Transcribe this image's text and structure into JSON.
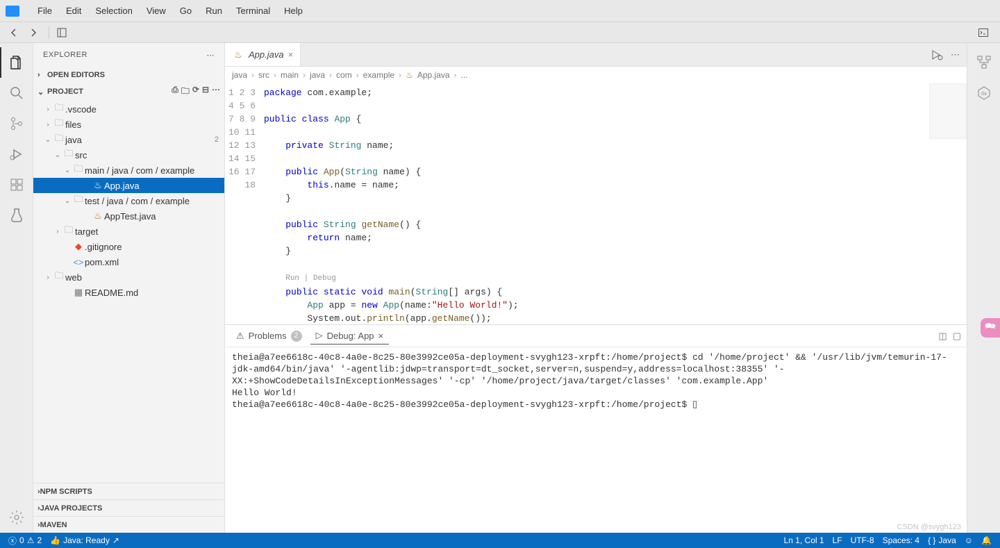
{
  "menu": [
    "File",
    "Edit",
    "Selection",
    "View",
    "Go",
    "Run",
    "Terminal",
    "Help"
  ],
  "sidebar": {
    "title": "EXPLORER",
    "openEditors": "OPEN EDITORS",
    "project": "PROJECT",
    "tree": {
      "vscode": ".vscode",
      "files": "files",
      "java": "java",
      "javaBadge": "2",
      "src": "src",
      "mainPath": "main / java / com / example",
      "appJava": "App.java",
      "testPath": "test / java / com / example",
      "appTest": "AppTest.java",
      "target": "target",
      "gitignore": ".gitignore",
      "pom": "pom.xml",
      "web": "web",
      "readme": "README.md"
    },
    "bottom": [
      "NPM SCRIPTS",
      "JAVA PROJECTS",
      "MAVEN"
    ]
  },
  "tab": {
    "label": "App.java"
  },
  "breadcrumb": [
    "java",
    "src",
    "main",
    "java",
    "com",
    "example",
    "App.java",
    "..."
  ],
  "codelens": "Run | Debug",
  "code": {
    "lines": [
      {
        "n": 1
      },
      {
        "n": 2
      },
      {
        "n": 3
      },
      {
        "n": 4
      },
      {
        "n": 5
      },
      {
        "n": 6
      },
      {
        "n": 7
      },
      {
        "n": 8
      },
      {
        "n": 9
      },
      {
        "n": 10
      },
      {
        "n": 11
      },
      {
        "n": 12
      },
      {
        "n": 13
      },
      {
        "n": 14
      },
      {
        "n": 15
      },
      {
        "n": 16
      },
      {
        "n": 17
      },
      {
        "n": 18
      }
    ]
  },
  "panel": {
    "problems": "Problems",
    "problemsCount": "2",
    "debug": "Debug: App"
  },
  "terminal": "theia@a7ee6618c-40c8-4a0e-8c25-80e3992ce05a-deployment-svygh123-xrpft:/home/project$ cd '/home/project' && '/usr/lib/jvm/temurin-17-jdk-amd64/bin/java' '-agentlib:jdwp=transport=dt_socket,server=n,suspend=y,address=localhost:38355' '-XX:+ShowCodeDetailsInExceptionMessages' '-cp' '/home/project/java/target/classes' 'com.example.App'\nHello World!\ntheia@a7ee6618c-40c8-4a0e-8c25-80e3992ce05a-deployment-svygh123-xrpft:/home/project$ ▯",
  "status": {
    "errors": "0",
    "warnings": "2",
    "javaReady": "Java: Ready",
    "lnCol": "Ln 1, Col 1",
    "lf": "LF",
    "encoding": "UTF-8",
    "spaces": "Spaces: 4",
    "lang": "Java"
  },
  "watermark": "CSDN @svygh123"
}
